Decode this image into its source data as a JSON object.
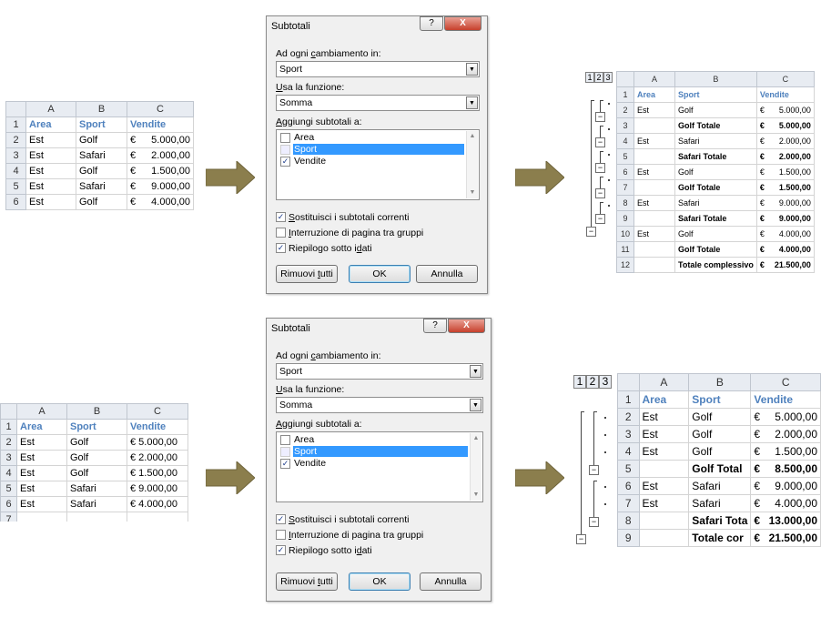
{
  "sheet1": {
    "cols": [
      "A",
      "B",
      "C"
    ],
    "rows": [
      {
        "n": "1",
        "a": "Area",
        "b": "Sport",
        "c": "Vendite",
        "hdr": true
      },
      {
        "n": "2",
        "a": "Est",
        "b": "Golf",
        "cs": "€",
        "cv": "5.000,00"
      },
      {
        "n": "3",
        "a": "Est",
        "b": "Safari",
        "cs": "€",
        "cv": "2.000,00"
      },
      {
        "n": "4",
        "a": "Est",
        "b": "Golf",
        "cs": "€",
        "cv": "1.500,00"
      },
      {
        "n": "5",
        "a": "Est",
        "b": "Safari",
        "cs": "€",
        "cv": "9.000,00"
      },
      {
        "n": "6",
        "a": "Est",
        "b": "Golf",
        "cs": "€",
        "cv": "4.000,00"
      }
    ]
  },
  "sheet2": {
    "cols": [
      "A",
      "B",
      "C"
    ],
    "rows": [
      {
        "n": "1",
        "a": "Area",
        "b": "Sport",
        "c": "Vendite",
        "hdr": true
      },
      {
        "n": "2",
        "a": "Est",
        "b": "Golf",
        "c": "€ 5.000,00"
      },
      {
        "n": "3",
        "a": "Est",
        "b": "Golf",
        "c": "€ 2.000,00"
      },
      {
        "n": "4",
        "a": "Est",
        "b": "Golf",
        "c": "€ 1.500,00"
      },
      {
        "n": "5",
        "a": "Est",
        "b": "Safari",
        "c": "€ 9.000,00"
      },
      {
        "n": "6",
        "a": "Est",
        "b": "Safari",
        "c": "€ 4.000,00"
      },
      {
        "n": "7",
        "a": "",
        "b": "",
        "c": ""
      }
    ]
  },
  "dialog": {
    "title": "Subtotali",
    "help": "?",
    "close": "X",
    "label_change_pre": "Ad ogni ",
    "label_change_u": "c",
    "label_change_post": "ambiamento in:",
    "change_value": "Sport",
    "label_func_u": "U",
    "label_func_post": "sa la funzione:",
    "func_value": "Somma",
    "label_add_u": "A",
    "label_add_post": "ggiungi subtotali a:",
    "list": [
      {
        "label": "Area",
        "checked": false,
        "selected": false
      },
      {
        "label": "Sport",
        "checked": false,
        "selected": true
      },
      {
        "label": "Vendite",
        "checked": true,
        "selected": false
      }
    ],
    "opt_replace_u": "S",
    "opt_replace_post": "ostituisci i subtotali correnti",
    "opt_break_u": "I",
    "opt_break_post": "nterruzione di pagina tra gruppi",
    "opt_summary_pre": "Riepilogo sotto i ",
    "opt_summary_u": "d",
    "opt_summary_post": "ati",
    "opt_replace_checked": true,
    "opt_break_checked": false,
    "opt_summary_checked": true,
    "btn_remove_pre": "Rimuovi ",
    "btn_remove_u": "t",
    "btn_remove_post": "utti",
    "btn_ok": "OK",
    "btn_cancel": "Annulla"
  },
  "result1": {
    "levels": [
      "1",
      "2",
      "3"
    ],
    "cols": [
      "A",
      "B",
      "C"
    ],
    "rows": [
      {
        "n": "1",
        "a": "Area",
        "b": "Sport",
        "c": "Vendite",
        "hdr": true
      },
      {
        "n": "2",
        "a": "Est",
        "b": "Golf",
        "cs": "€",
        "cv": "5.000,00"
      },
      {
        "n": "3",
        "a": "",
        "b": "Golf Totale",
        "cs": "€",
        "cv": "5.000,00",
        "bold": true
      },
      {
        "n": "4",
        "a": "Est",
        "b": "Safari",
        "cs": "€",
        "cv": "2.000,00"
      },
      {
        "n": "5",
        "a": "",
        "b": "Safari Totale",
        "cs": "€",
        "cv": "2.000,00",
        "bold": true
      },
      {
        "n": "6",
        "a": "Est",
        "b": "Golf",
        "cs": "€",
        "cv": "1.500,00"
      },
      {
        "n": "7",
        "a": "",
        "b": "Golf Totale",
        "cs": "€",
        "cv": "1.500,00",
        "bold": true
      },
      {
        "n": "8",
        "a": "Est",
        "b": "Safari",
        "cs": "€",
        "cv": "9.000,00"
      },
      {
        "n": "9",
        "a": "",
        "b": "Safari Totale",
        "cs": "€",
        "cv": "9.000,00",
        "bold": true
      },
      {
        "n": "10",
        "a": "Est",
        "b": "Golf",
        "cs": "€",
        "cv": "4.000,00"
      },
      {
        "n": "11",
        "a": "",
        "b": "Golf Totale",
        "cs": "€",
        "cv": "4.000,00",
        "bold": true
      },
      {
        "n": "12",
        "a": "",
        "b": "Totale complessivo",
        "cs": "€",
        "cv": "21.500,00",
        "bold": true
      }
    ]
  },
  "result2": {
    "levels": [
      "1",
      "2",
      "3"
    ],
    "cols": [
      "A",
      "B",
      "C"
    ],
    "rows": [
      {
        "n": "1",
        "a": "Area",
        "b": "Sport",
        "c": "Vendite",
        "hdr": true
      },
      {
        "n": "2",
        "a": "Est",
        "b": "Golf",
        "cs": "€",
        "cv": "5.000,00"
      },
      {
        "n": "3",
        "a": "Est",
        "b": "Golf",
        "cs": "€",
        "cv": "2.000,00"
      },
      {
        "n": "4",
        "a": "Est",
        "b": "Golf",
        "cs": "€",
        "cv": "1.500,00"
      },
      {
        "n": "5",
        "a": "",
        "b": "Golf Total",
        "cs": "€",
        "cv": "8.500,00",
        "bold": true
      },
      {
        "n": "6",
        "a": "Est",
        "b": "Safari",
        "cs": "€",
        "cv": "9.000,00"
      },
      {
        "n": "7",
        "a": "Est",
        "b": "Safari",
        "cs": "€",
        "cv": "4.000,00"
      },
      {
        "n": "8",
        "a": "",
        "b": "Safari Tota",
        "cs": "€",
        "cv": "13.000,00",
        "bold": true
      },
      {
        "n": "9",
        "a": "",
        "b": "Totale cor",
        "cs": "€",
        "cv": "21.500,00",
        "bold": true
      }
    ]
  },
  "icons": {
    "arrow": "arrow-right-icon",
    "dropdown": "chevron-down-icon",
    "check": "checkmark-icon",
    "collapse": "minus-icon"
  },
  "colors": {
    "arrow": "#8b7e4d",
    "header_text": "#4f81bd",
    "selection": "#3399ff"
  }
}
